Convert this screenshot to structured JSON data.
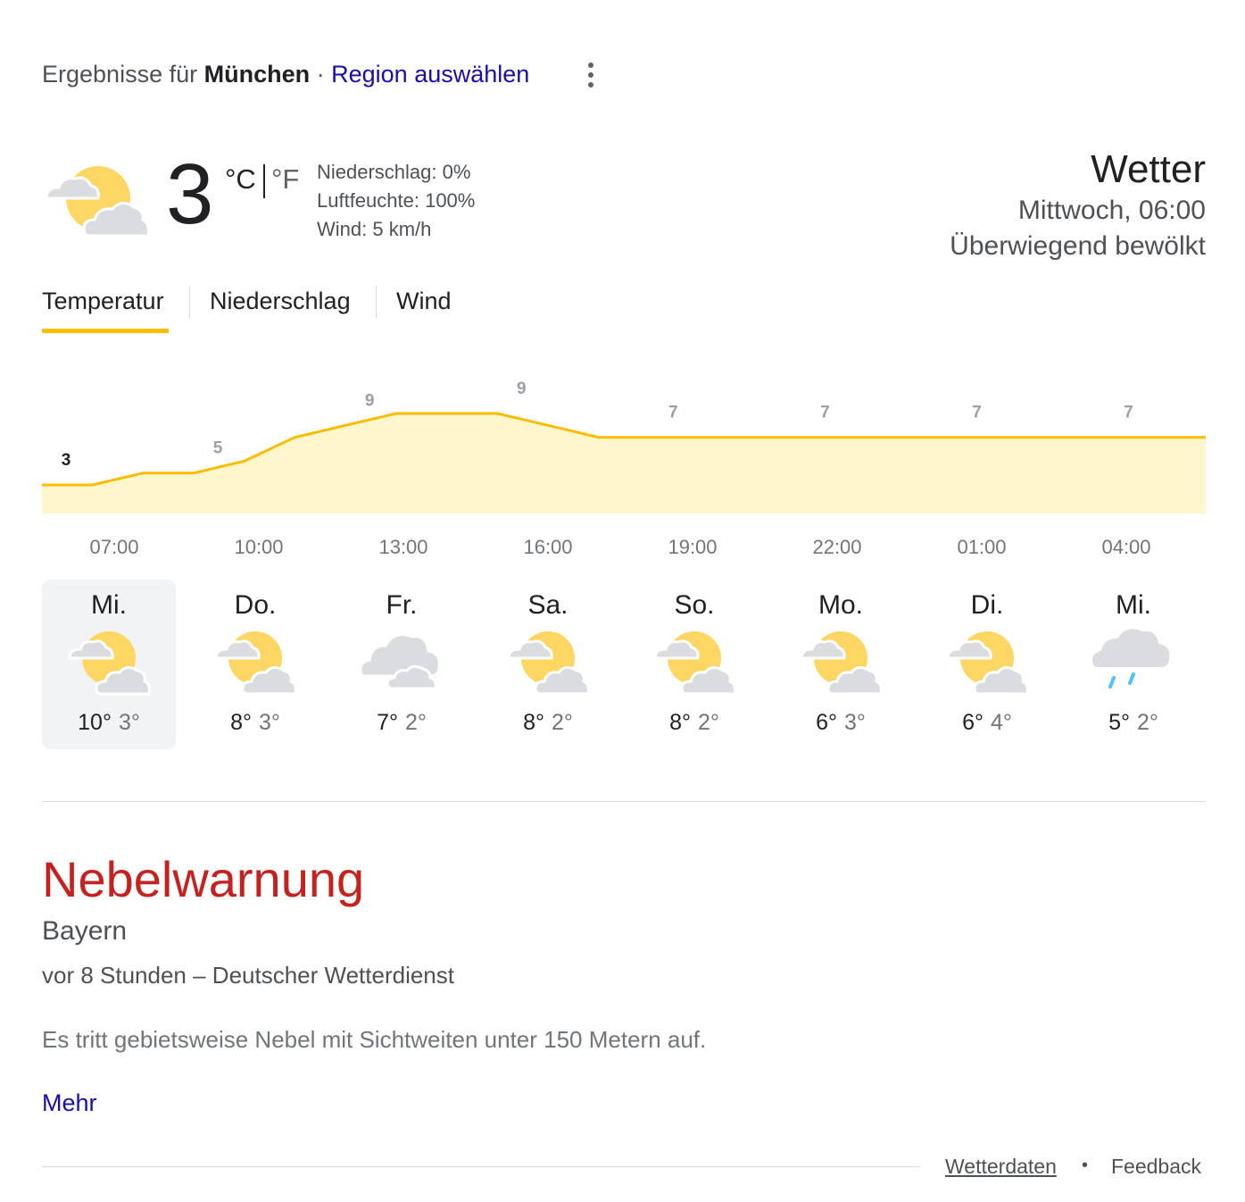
{
  "header": {
    "results_prefix": "Ergebnisse für",
    "location": "München",
    "separator": "·",
    "region_link": "Region auswählen"
  },
  "current": {
    "icon": "partly-cloudy-icon",
    "temperature": "3",
    "unit_c": "°C",
    "unit_f": "°F",
    "precipitation": "Niederschlag: 0%",
    "humidity": "Luftfeuchte: 100%",
    "wind": "Wind: 5 km/h",
    "title": "Wetter",
    "datetime": "Mittwoch, 06:00",
    "condition": "Überwiegend bewölkt"
  },
  "tabs": [
    {
      "label": "Temperatur",
      "active": true
    },
    {
      "label": "Niederschlag",
      "active": false
    },
    {
      "label": "Wind",
      "active": false
    }
  ],
  "chart_data": {
    "type": "area",
    "x": [
      "06:00",
      "07:00",
      "08:00",
      "09:00",
      "10:00",
      "11:00",
      "12:00",
      "13:00",
      "14:00",
      "15:00",
      "16:00",
      "17:00",
      "18:00",
      "19:00",
      "20:00",
      "21:00",
      "22:00",
      "23:00",
      "00:00",
      "01:00",
      "02:00",
      "03:00",
      "04:00",
      "05:00"
    ],
    "values": [
      3,
      3,
      4,
      4,
      5,
      7,
      8,
      9,
      9,
      9,
      8,
      7,
      7,
      7,
      7,
      7,
      7,
      7,
      7,
      7,
      7,
      7,
      7,
      7
    ],
    "labels": [
      {
        "x_index": 0,
        "text": "3"
      },
      {
        "x_index": 3,
        "text": "5"
      },
      {
        "x_index": 6,
        "text": "9"
      },
      {
        "x_index": 9,
        "text": "9"
      },
      {
        "x_index": 12,
        "text": "7"
      },
      {
        "x_index": 15,
        "text": "7"
      },
      {
        "x_index": 18,
        "text": "7"
      },
      {
        "x_index": 21,
        "text": "7"
      }
    ],
    "tick_labels": [
      "07:00",
      "10:00",
      "13:00",
      "16:00",
      "19:00",
      "22:00",
      "01:00",
      "04:00"
    ],
    "colors": {
      "line": "#fbbc04",
      "fill": "#fef7cb",
      "label_first": "#202124",
      "label": "#9aa0a6"
    }
  },
  "days": [
    {
      "name": "Mi.",
      "icon": "partly-cloudy-icon",
      "high": "10°",
      "low": "3°",
      "selected": true
    },
    {
      "name": "Do.",
      "icon": "partly-cloudy-icon",
      "high": "8°",
      "low": "3°",
      "selected": false
    },
    {
      "name": "Fr.",
      "icon": "cloudy-icon",
      "high": "7°",
      "low": "2°",
      "selected": false
    },
    {
      "name": "Sa.",
      "icon": "partly-cloudy-icon",
      "high": "8°",
      "low": "2°",
      "selected": false
    },
    {
      "name": "So.",
      "icon": "partly-cloudy-icon",
      "high": "8°",
      "low": "2°",
      "selected": false
    },
    {
      "name": "Mo.",
      "icon": "partly-cloudy-icon",
      "high": "6°",
      "low": "3°",
      "selected": false
    },
    {
      "name": "Di.",
      "icon": "partly-cloudy-icon",
      "high": "6°",
      "low": "4°",
      "selected": false
    },
    {
      "name": "Mi.",
      "icon": "rain-icon",
      "high": "5°",
      "low": "2°",
      "selected": false
    }
  ],
  "warning": {
    "title": "Nebelwarnung",
    "region": "Bayern",
    "meta": "vor 8 Stunden – Deutscher Wetterdienst",
    "text": "Es tritt gebietsweise Nebel mit Sichtweiten unter 150 Metern auf.",
    "more": "Mehr"
  },
  "footer": {
    "data_link": "Wetterdaten",
    "dot": "•",
    "feedback": "Feedback"
  }
}
